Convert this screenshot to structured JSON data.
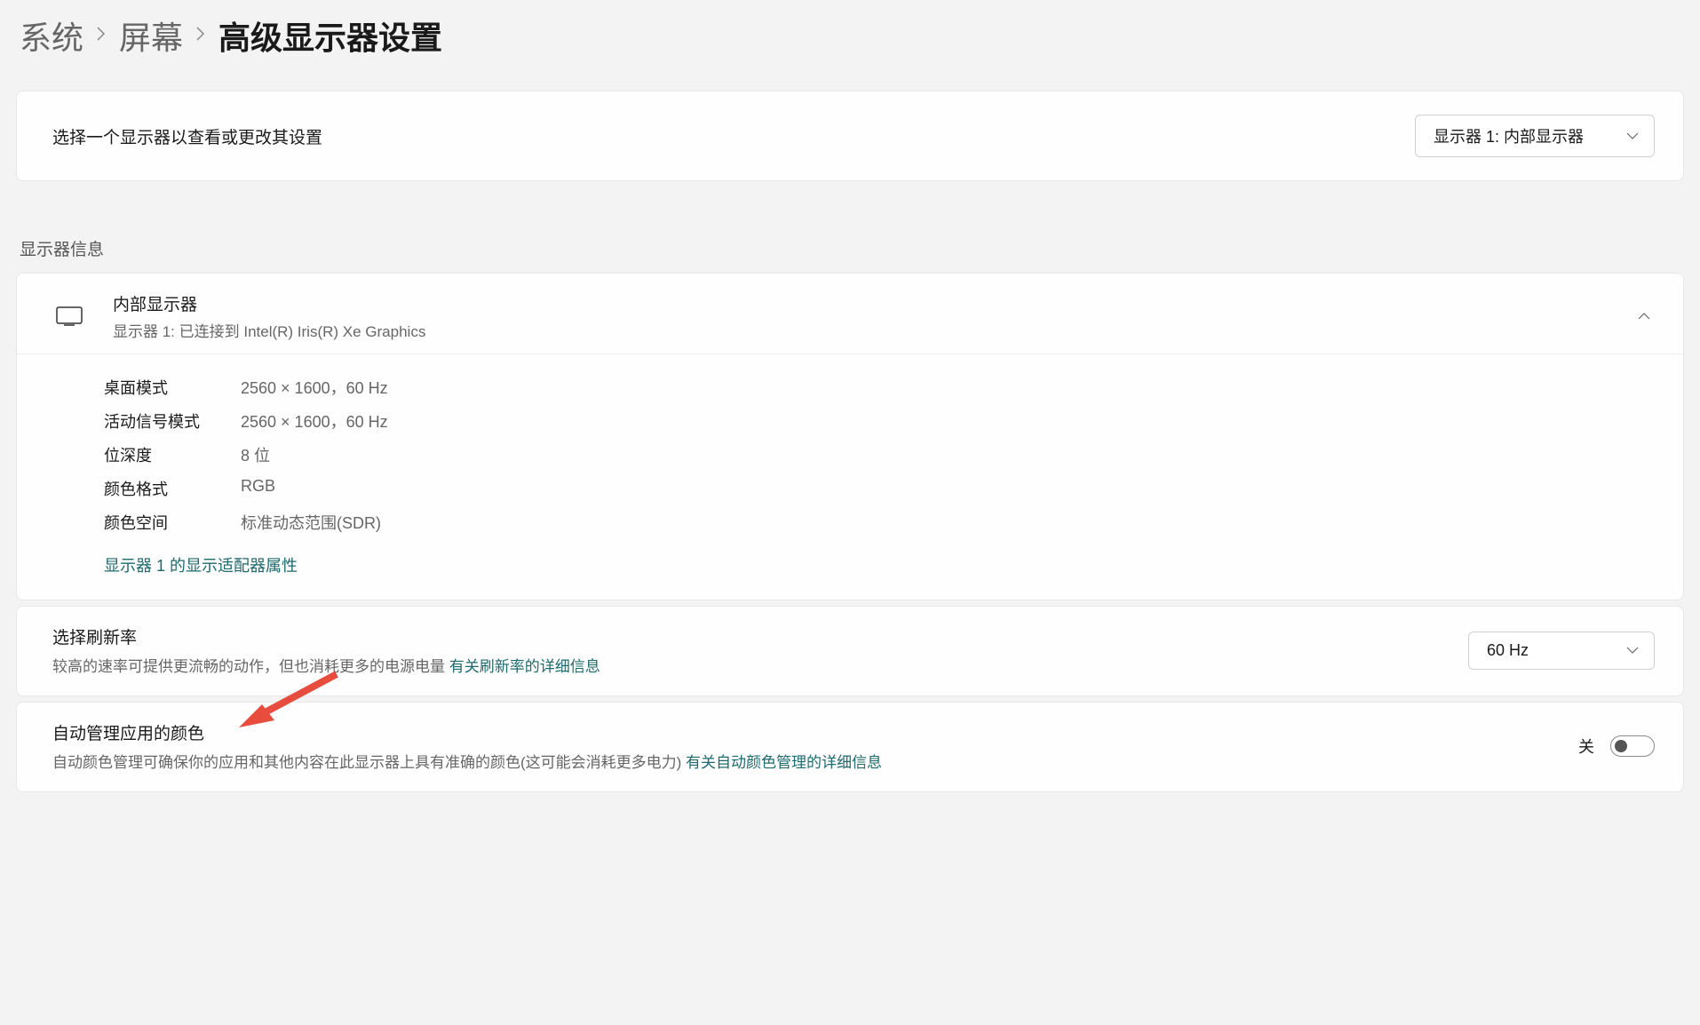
{
  "breadcrumb": {
    "item1": "系统",
    "item2": "屏幕",
    "current": "高级显示器设置"
  },
  "select_display": {
    "label": "选择一个显示器以查看或更改其设置",
    "value": "显示器 1: 内部显示器"
  },
  "section_heading": "显示器信息",
  "display_info": {
    "title": "内部显示器",
    "subtitle": "显示器 1: 已连接到 Intel(R) Iris(R) Xe Graphics",
    "props": {
      "desktop_mode_key": "桌面模式",
      "desktop_mode_val": "2560 × 1600，60 Hz",
      "active_signal_key": "活动信号模式",
      "active_signal_val": "2560 × 1600，60 Hz",
      "bit_depth_key": "位深度",
      "bit_depth_val": "8 位",
      "color_format_key": "颜色格式",
      "color_format_val": "RGB",
      "color_space_key": "颜色空间",
      "color_space_val": "标准动态范围(SDR)"
    },
    "adapter_link": "显示器 1 的显示适配器属性"
  },
  "refresh_rate": {
    "title": "选择刷新率",
    "desc": "较高的速率可提供更流畅的动作，但也消耗更多的电源电量 ",
    "link": "有关刷新率的详细信息",
    "value": "60 Hz"
  },
  "auto_color": {
    "title": "自动管理应用的颜色",
    "desc": "自动颜色管理可确保你的应用和其他内容在此显示器上具有准确的颜色(这可能会消耗更多电力) ",
    "link": "有关自动颜色管理的详细信息",
    "toggle_state": "关"
  }
}
